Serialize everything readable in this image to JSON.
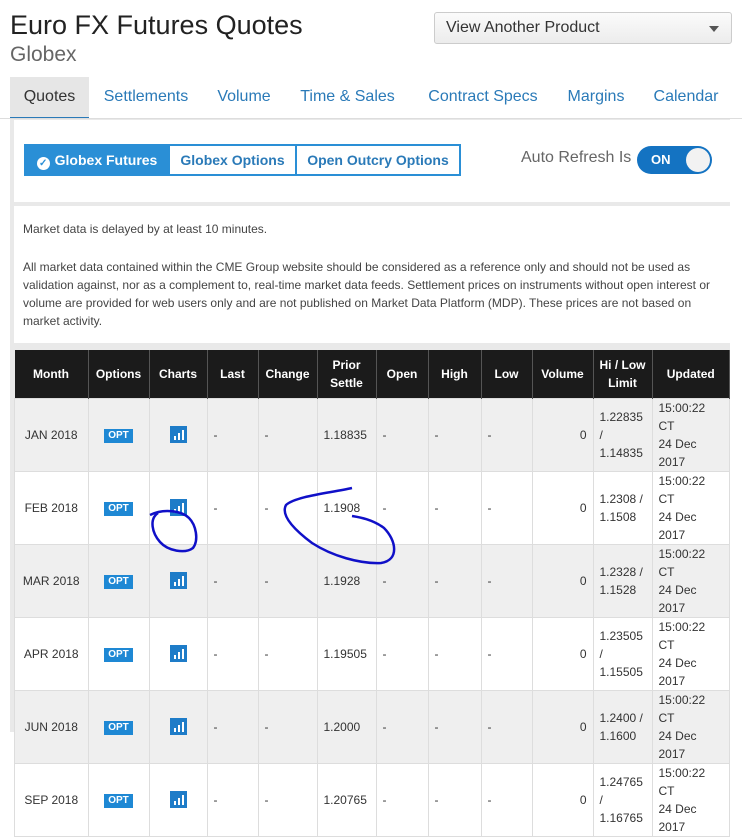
{
  "header": {
    "title": "Euro FX Futures Quotes",
    "subtitle": "Globex",
    "product_select": "View Another Product"
  },
  "tabs": [
    "Quotes",
    "Settlements",
    "Volume",
    "Time & Sales",
    "Contract Specs",
    "Margins",
    "Calendar"
  ],
  "active_tab": "Quotes",
  "segments": [
    "Globex Futures",
    "Globex Options",
    "Open Outcry Options"
  ],
  "active_segment": "Globex Futures",
  "auto_refresh": {
    "label": "Auto Refresh Is",
    "state": "ON"
  },
  "notice": {
    "line1": "Market data is delayed by at least 10 minutes.",
    "line2": "All market data contained within the CME Group website should be considered as a reference only and should not be used as validation against, nor as a complement to, real-time market data feeds. Settlement prices on instruments without open interest or volume are provided for web users only and are not published on Market Data Platform (MDP). These prices are not based on market activity."
  },
  "table": {
    "headers": [
      "Month",
      "Options",
      "Charts",
      "Last",
      "Change",
      "Prior Settle",
      "Open",
      "High",
      "Low",
      "Volume",
      "Hi / Low Limit",
      "Updated"
    ],
    "opt_label": "OPT",
    "rows": [
      {
        "month": "JAN 2018",
        "last": "-",
        "change": "-",
        "prior": "1.18835",
        "open": "-",
        "high": "-",
        "low": "-",
        "volume": "0",
        "hi": "1.22835",
        "sep": "/",
        "lo": "1.14835",
        "time": "15:00:22 CT",
        "date": "24 Dec 2017"
      },
      {
        "month": "FEB 2018",
        "last": "-",
        "change": "-",
        "prior": "1.1908",
        "open": "-",
        "high": "-",
        "low": "-",
        "volume": "0",
        "hi": "1.2308 /",
        "sep": "",
        "lo": "1.1508",
        "time": "15:00:22 CT",
        "date": "24 Dec 2017"
      },
      {
        "month": "MAR 2018",
        "last": "-",
        "change": "-",
        "prior": "1.1928",
        "open": "-",
        "high": "-",
        "low": "-",
        "volume": "0",
        "hi": "1.2328 /",
        "sep": "",
        "lo": "1.1528",
        "time": "15:00:22 CT",
        "date": "24 Dec 2017"
      },
      {
        "month": "APR 2018",
        "last": "-",
        "change": "-",
        "prior": "1.19505",
        "open": "-",
        "high": "-",
        "low": "-",
        "volume": "0",
        "hi": "1.23505",
        "sep": "/",
        "lo": "1.15505",
        "time": "15:00:22 CT",
        "date": "24 Dec 2017"
      },
      {
        "month": "JUN 2018",
        "last": "-",
        "change": "-",
        "prior": "1.2000",
        "open": "-",
        "high": "-",
        "low": "-",
        "volume": "0",
        "hi": "1.2400 /",
        "sep": "",
        "lo": "1.1600",
        "time": "15:00:22 CT",
        "date": "24 Dec 2017"
      },
      {
        "month": "SEP 2018",
        "last": "-",
        "change": "-",
        "prior": "1.20765",
        "open": "-",
        "high": "-",
        "low": "-",
        "volume": "0",
        "hi": "1.24765",
        "sep": "/",
        "lo": "1.16765",
        "time": "15:00:22 CT",
        "date": "24 Dec 2017"
      }
    ]
  },
  "colors": {
    "accent": "#2a8fd6",
    "header_bg": "#1b1b1b",
    "annotation": "#1010c8"
  }
}
